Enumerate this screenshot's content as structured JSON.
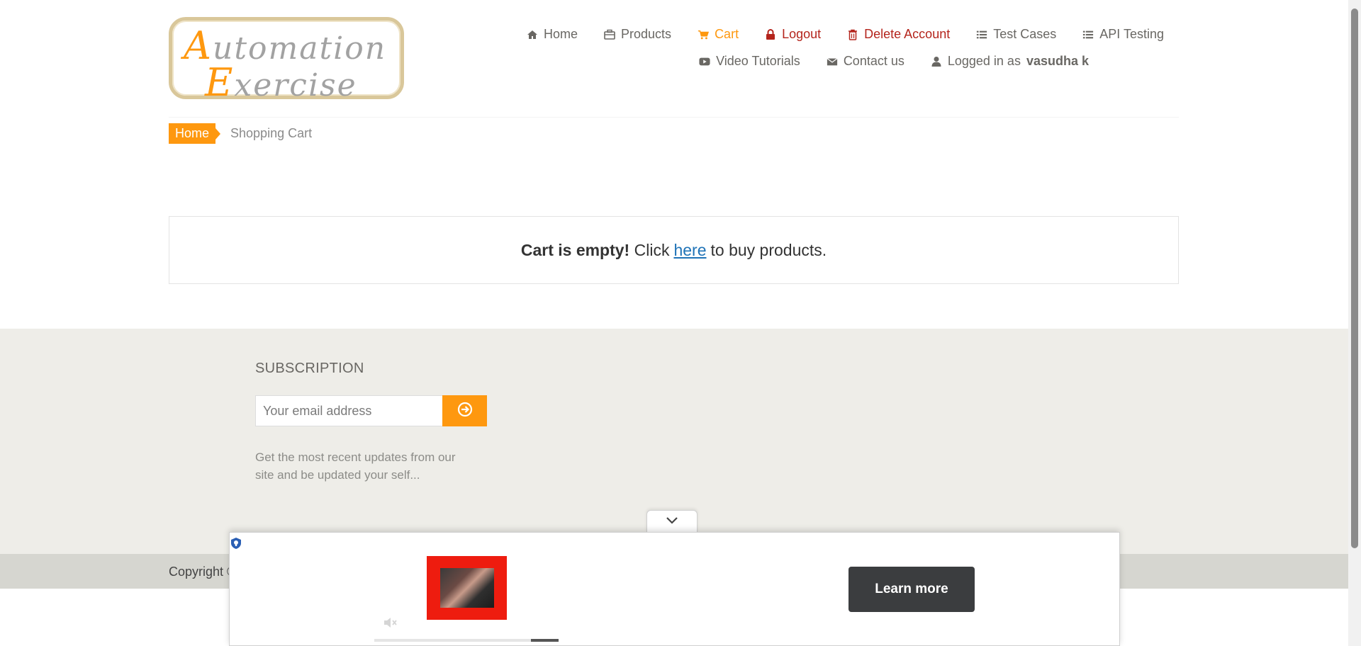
{
  "logo": {
    "line1_cap": "A",
    "line1_rest": "utomation",
    "line2_cap": "E",
    "line2_rest": "xercise"
  },
  "nav": {
    "row1": [
      {
        "label": "Home",
        "icon": "home-icon"
      },
      {
        "label": "Products",
        "icon": "briefcase-icon"
      },
      {
        "label": "Cart",
        "icon": "cart-icon"
      },
      {
        "label": "Logout",
        "icon": "lock-icon"
      },
      {
        "label": "Delete Account",
        "icon": "trash-icon"
      },
      {
        "label": "Test Cases",
        "icon": "list-icon"
      },
      {
        "label": "API Testing",
        "icon": "list-icon"
      }
    ],
    "row2": [
      {
        "label": "Video Tutorials",
        "icon": "youtube-icon"
      },
      {
        "label": "Contact us",
        "icon": "envelope-icon"
      },
      {
        "label_prefix": "Logged in as",
        "username": "vasudha k",
        "icon": "user-icon"
      }
    ]
  },
  "breadcrumb": {
    "home": "Home",
    "current": "Shopping Cart"
  },
  "cart": {
    "empty_bold": "Cart is empty!",
    "click_text": "Click",
    "link_text": "here",
    "suffix": "to buy products."
  },
  "footer": {
    "subscription_title": "SUBSCRIPTION",
    "email_placeholder": "Your email address",
    "subscription_text": "Get the most recent updates from our site and be updated your self...",
    "copyright": "Copyright ©"
  },
  "ad": {
    "cta_label": "Learn more"
  },
  "colors": {
    "accent": "#fe980f",
    "danger": "#b4241c",
    "footer_bg": "#eeede8",
    "footer_bottom_bg": "#d6d6d0",
    "link": "#1f73b7",
    "ad_thumb_border": "#ee1c0f"
  }
}
